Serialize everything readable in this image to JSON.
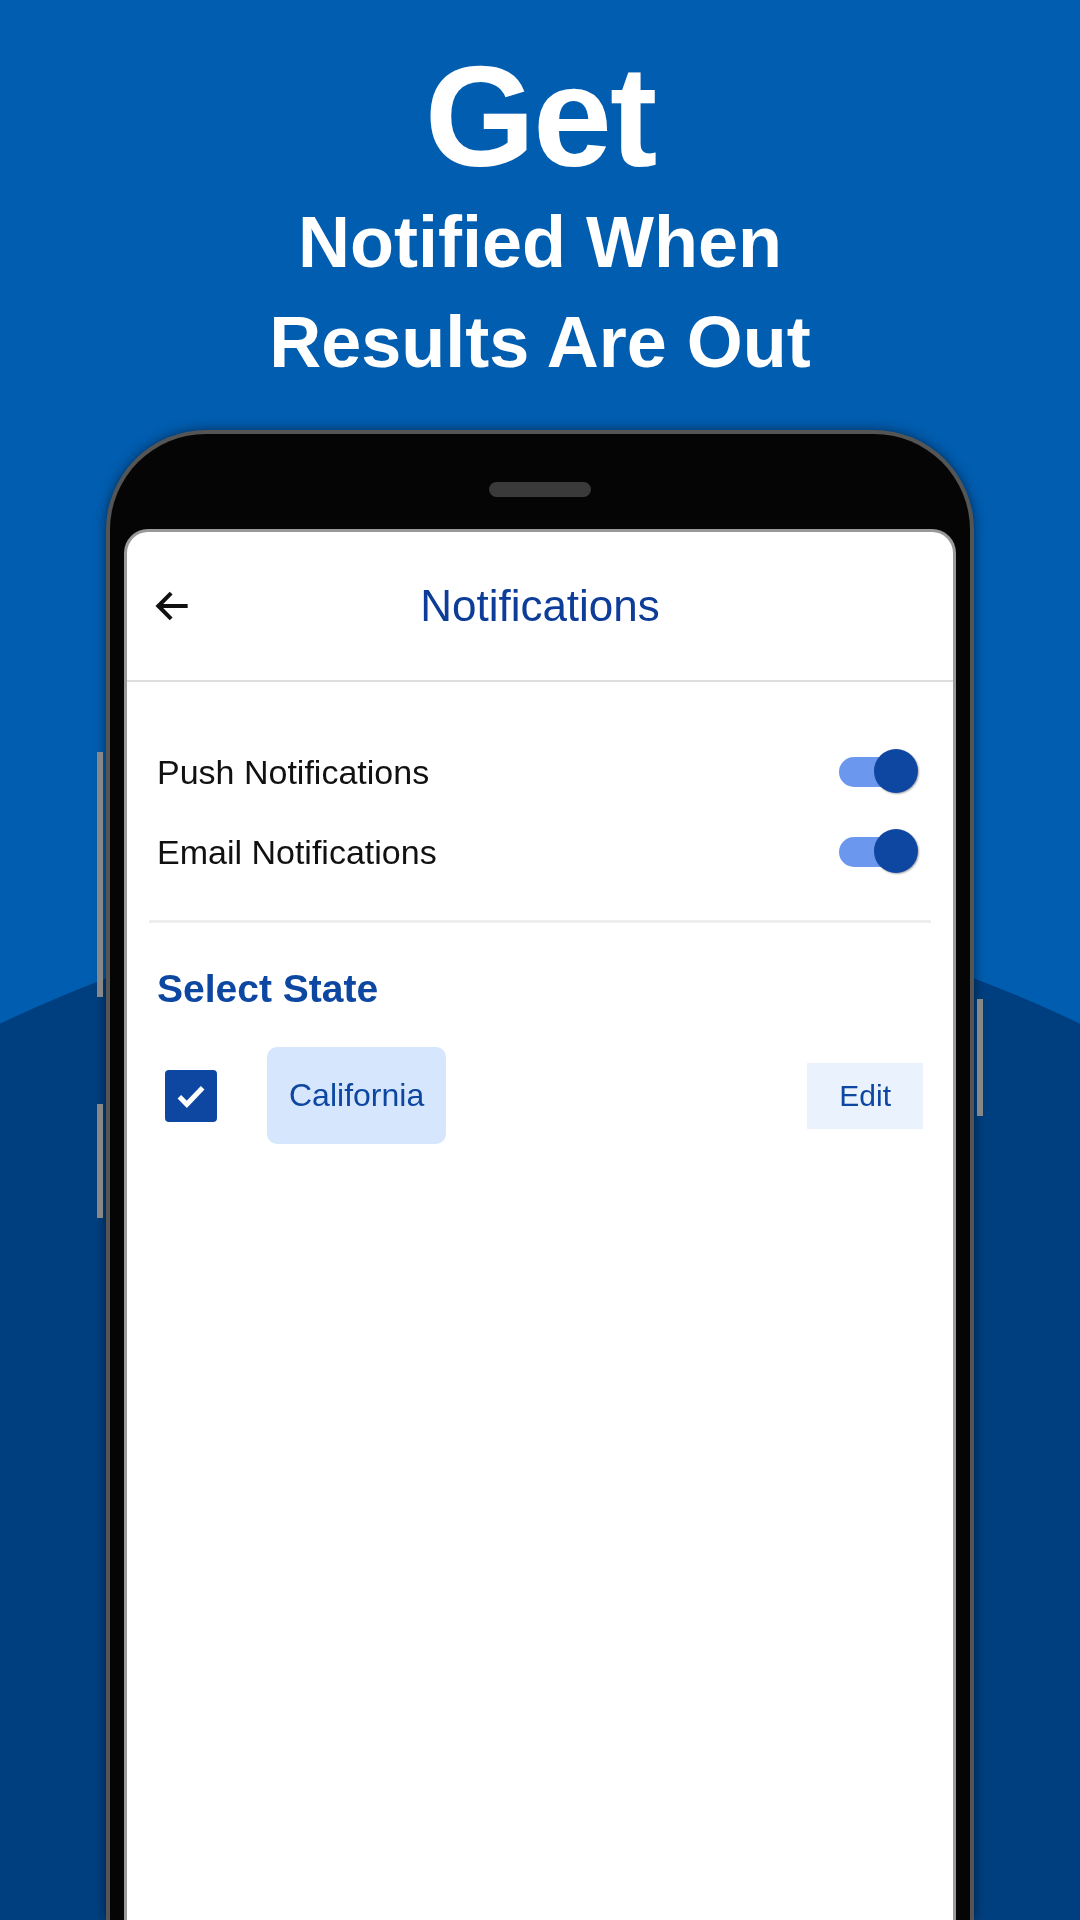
{
  "headline": {
    "title": "Get",
    "subtitle_lines": [
      "Notified When",
      "Results Are Out"
    ]
  },
  "screen": {
    "title": "Notifications",
    "toggles": [
      {
        "label": "Push Notifications",
        "on": true
      },
      {
        "label": "Email Notifications",
        "on": true
      }
    ],
    "section_title": "Select State",
    "states": [
      {
        "name": "California",
        "checked": true,
        "action": "Edit"
      }
    ]
  }
}
